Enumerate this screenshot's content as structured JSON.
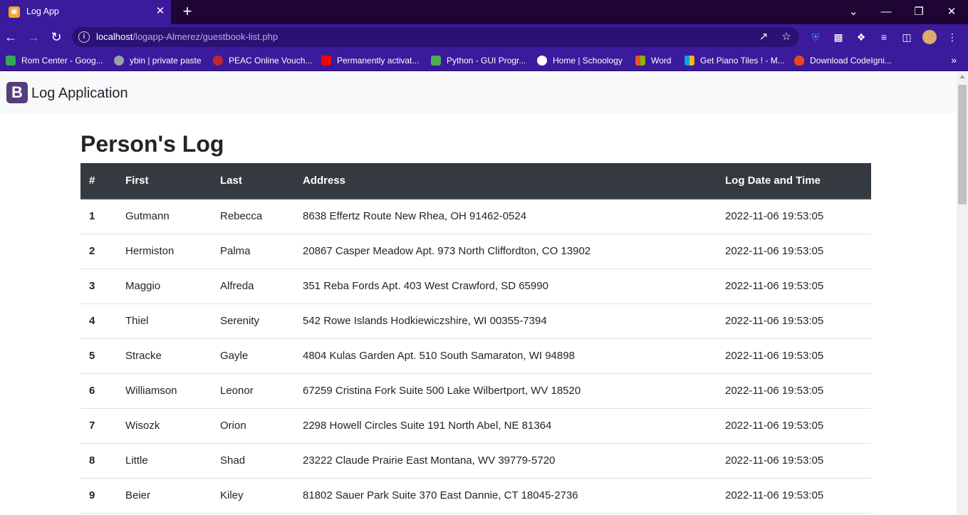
{
  "browser": {
    "tab_title": "Log App",
    "tab_icon": "xampp-favicon-icon",
    "url_host": "localhost",
    "url_path": "/logapp-Almerez/guestbook-list.php",
    "accent_color": "#3b1a9c"
  },
  "bookmarks": [
    {
      "label": "Rom Center - Goog...",
      "icon": "google-drive-icon",
      "color": "#34a853"
    },
    {
      "label": "ybin | private paste",
      "icon": "ybin-icon",
      "color": "#9aa0a6"
    },
    {
      "label": "PEAC Online Vouch...",
      "icon": "peac-icon",
      "color": "#c62828"
    },
    {
      "label": "Permanently activat...",
      "icon": "youtube-icon",
      "color": "#ff0000"
    },
    {
      "label": "Python - GUI Progr...",
      "icon": "python-icon",
      "color": "#4caf50"
    },
    {
      "label": "Home | Schoology",
      "icon": "schoology-icon",
      "color": "#ffffff"
    },
    {
      "label": "Word",
      "icon": "microsoft-icon",
      "color": "#f25022"
    },
    {
      "label": "Get Piano Tiles ! - M...",
      "icon": "microsoft-icon",
      "color": "#7fba00"
    },
    {
      "label": "Download CodeIgni...",
      "icon": "codeigniter-icon",
      "color": "#ee4323"
    }
  ],
  "navbar": {
    "brand_letter": "B",
    "brand_text": "Log Application"
  },
  "main": {
    "heading": "Person's Log",
    "columns": [
      "#",
      "First",
      "Last",
      "Address",
      "Log Date and Time"
    ],
    "rows": [
      [
        "1",
        "Gutmann",
        "Rebecca",
        "8638 Effertz Route New Rhea, OH 91462-0524",
        "2022-11-06 19:53:05"
      ],
      [
        "2",
        "Hermiston",
        "Palma",
        "20867 Casper Meadow Apt. 973 North Cliffordton, CO 13902",
        "2022-11-06 19:53:05"
      ],
      [
        "3",
        "Maggio",
        "Alfreda",
        "351 Reba Fords Apt. 403 West Crawford, SD 65990",
        "2022-11-06 19:53:05"
      ],
      [
        "4",
        "Thiel",
        "Serenity",
        "542 Rowe Islands Hodkiewiczshire, WI 00355-7394",
        "2022-11-06 19:53:05"
      ],
      [
        "5",
        "Stracke",
        "Gayle",
        "4804 Kulas Garden Apt. 510 South Samaraton, WI 94898",
        "2022-11-06 19:53:05"
      ],
      [
        "6",
        "Williamson",
        "Leonor",
        "67259 Cristina Fork Suite 500 Lake Wilbertport, WV 18520",
        "2022-11-06 19:53:05"
      ],
      [
        "7",
        "Wisozk",
        "Orion",
        "2298 Howell Circles Suite 191 North Abel, NE 81364",
        "2022-11-06 19:53:05"
      ],
      [
        "8",
        "Little",
        "Shad",
        "23222 Claude Prairie East Montana, WV 39779-5720",
        "2022-11-06 19:53:05"
      ],
      [
        "9",
        "Beier",
        "Kiley",
        "81802 Sauer Park Suite 370 East Dannie, CT 18045-2736",
        "2022-11-06 19:53:05"
      ]
    ]
  }
}
